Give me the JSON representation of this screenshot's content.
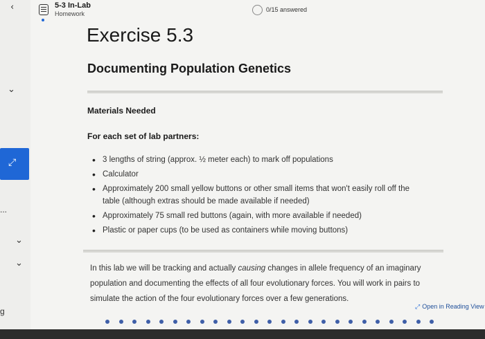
{
  "breadcrumb": {
    "title": "5-3 In-Lab",
    "subtitle": "Homework"
  },
  "progress": {
    "text": "0/15 answered",
    "fraction": 0
  },
  "nav": {
    "back_icon": "chevron-left-icon",
    "collapse_icons": [
      "chevron-down-icon",
      "chevron-down-icon",
      "chevron-down-icon"
    ],
    "expand_icon": "expand-icon",
    "rail_dots": "...",
    "rail_letter": "g"
  },
  "content": {
    "title": "Exercise 5.3",
    "subtitle": "Documenting Population Genetics",
    "materials_heading": "Materials Needed",
    "for_each_heading": "For each set of lab partners:",
    "items": [
      "3 lengths of string (approx. ½ meter each) to mark off populations",
      "Calculator",
      "Approximately 200 small yellow buttons or other small items that won't easily roll off the table (although extras should be made available if needed)",
      "Approximately 75 small red buttons (again, with more available if needed)",
      "Plastic or paper cups (to be used as containers while moving buttons)"
    ],
    "paragraph_before": "In this lab we will be tracking and actually ",
    "paragraph_em": "causing",
    "paragraph_after": " changes in allele frequency of an imaginary population and documenting the effects of all four evolutionary forces. You will work in pairs to simulate the action of the four evolutionary forces over a few generations."
  },
  "reading_view": {
    "label": "Open in Reading View",
    "icon": "external-expand-icon"
  },
  "colors": {
    "accent": "#1f67d6",
    "page_dots": "#3f5fa8"
  }
}
